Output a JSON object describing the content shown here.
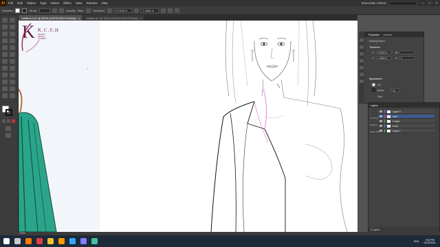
{
  "app": {
    "logo_text": "Ai"
  },
  "menu": [
    "File",
    "Edit",
    "Object",
    "Type",
    "Select",
    "Effect",
    "View",
    "Window",
    "Help"
  ],
  "workspace": "Essentials Classic",
  "control_bar": {
    "selection": "Selection",
    "stroke_label": "Stroke",
    "stroke_value": "",
    "opacity_label": "Opacity",
    "style_label": "Style",
    "transform_label": "Transform",
    "width_value": "6.7005 in",
    "height_value": "1.2882 in"
  },
  "tabs": [
    {
      "label": "Untitled-1.ai* @ 800% (CMYK/GPU Preview)",
      "close": "×"
    },
    {
      "label": "untitled.ai* @ 100% (CMYK/GPU Preview)",
      "close": "×"
    }
  ],
  "logo": {
    "letter": "K",
    "name": "K.C.S.H",
    "tagline": "FASHION DESIGN ACADEMY"
  },
  "properties": {
    "tabs": [
      "Properties",
      "Libraries"
    ],
    "no_selection": "Nothing Select",
    "transform_title": "Transform",
    "x_label": "X:",
    "x_value": "6.0002 in",
    "y_label": "Y:",
    "y_value": "1.2882 in",
    "w_label": "W:",
    "h_label": "H:",
    "h_value": "0",
    "appearance_title": "Appearance",
    "fill_label": "Fill",
    "stroke_label": "Stroke",
    "stroke_value": "1 pt",
    "opacity_label": "Opa"
  },
  "layers": {
    "tabs": [
      "Layers"
    ],
    "items": [
      {
        "name": "Layer 6",
        "color": "#4a7dff"
      },
      {
        "name": "dots",
        "color": "#ff3f3f"
      },
      {
        "name": "k have",
        "color": "#3fbf3f"
      },
      {
        "name": "body",
        "color": "#3f7fff"
      },
      {
        "name": "Layer 1",
        "color": "#3fbf3f"
      }
    ],
    "side_labels": [
      "Consolid",
      "Isolation",
      "Quick Actio"
    ],
    "footer": "5 Layers"
  },
  "status": {
    "zoom": "100%"
  },
  "taskbar": {
    "icons": [
      {
        "name": "windows-icon",
        "color": "#ffffff"
      },
      {
        "name": "search-icon",
        "color": "#cccccc"
      },
      {
        "name": "firefox-icon",
        "color": "#ff7a00"
      },
      {
        "name": "chrome-icon",
        "color": "#e04040"
      },
      {
        "name": "explorer-icon",
        "color": "#f0c030"
      },
      {
        "name": "illustrator-icon",
        "color": "#ff9a00"
      },
      {
        "name": "photoshop-icon",
        "color": "#31a8ff"
      },
      {
        "name": "media-icon",
        "color": "#8080ff"
      },
      {
        "name": "chat-icon",
        "color": "#40c0a0"
      }
    ],
    "time": "9:03 PM",
    "date": "02/19/2021",
    "lang": "ENG"
  }
}
